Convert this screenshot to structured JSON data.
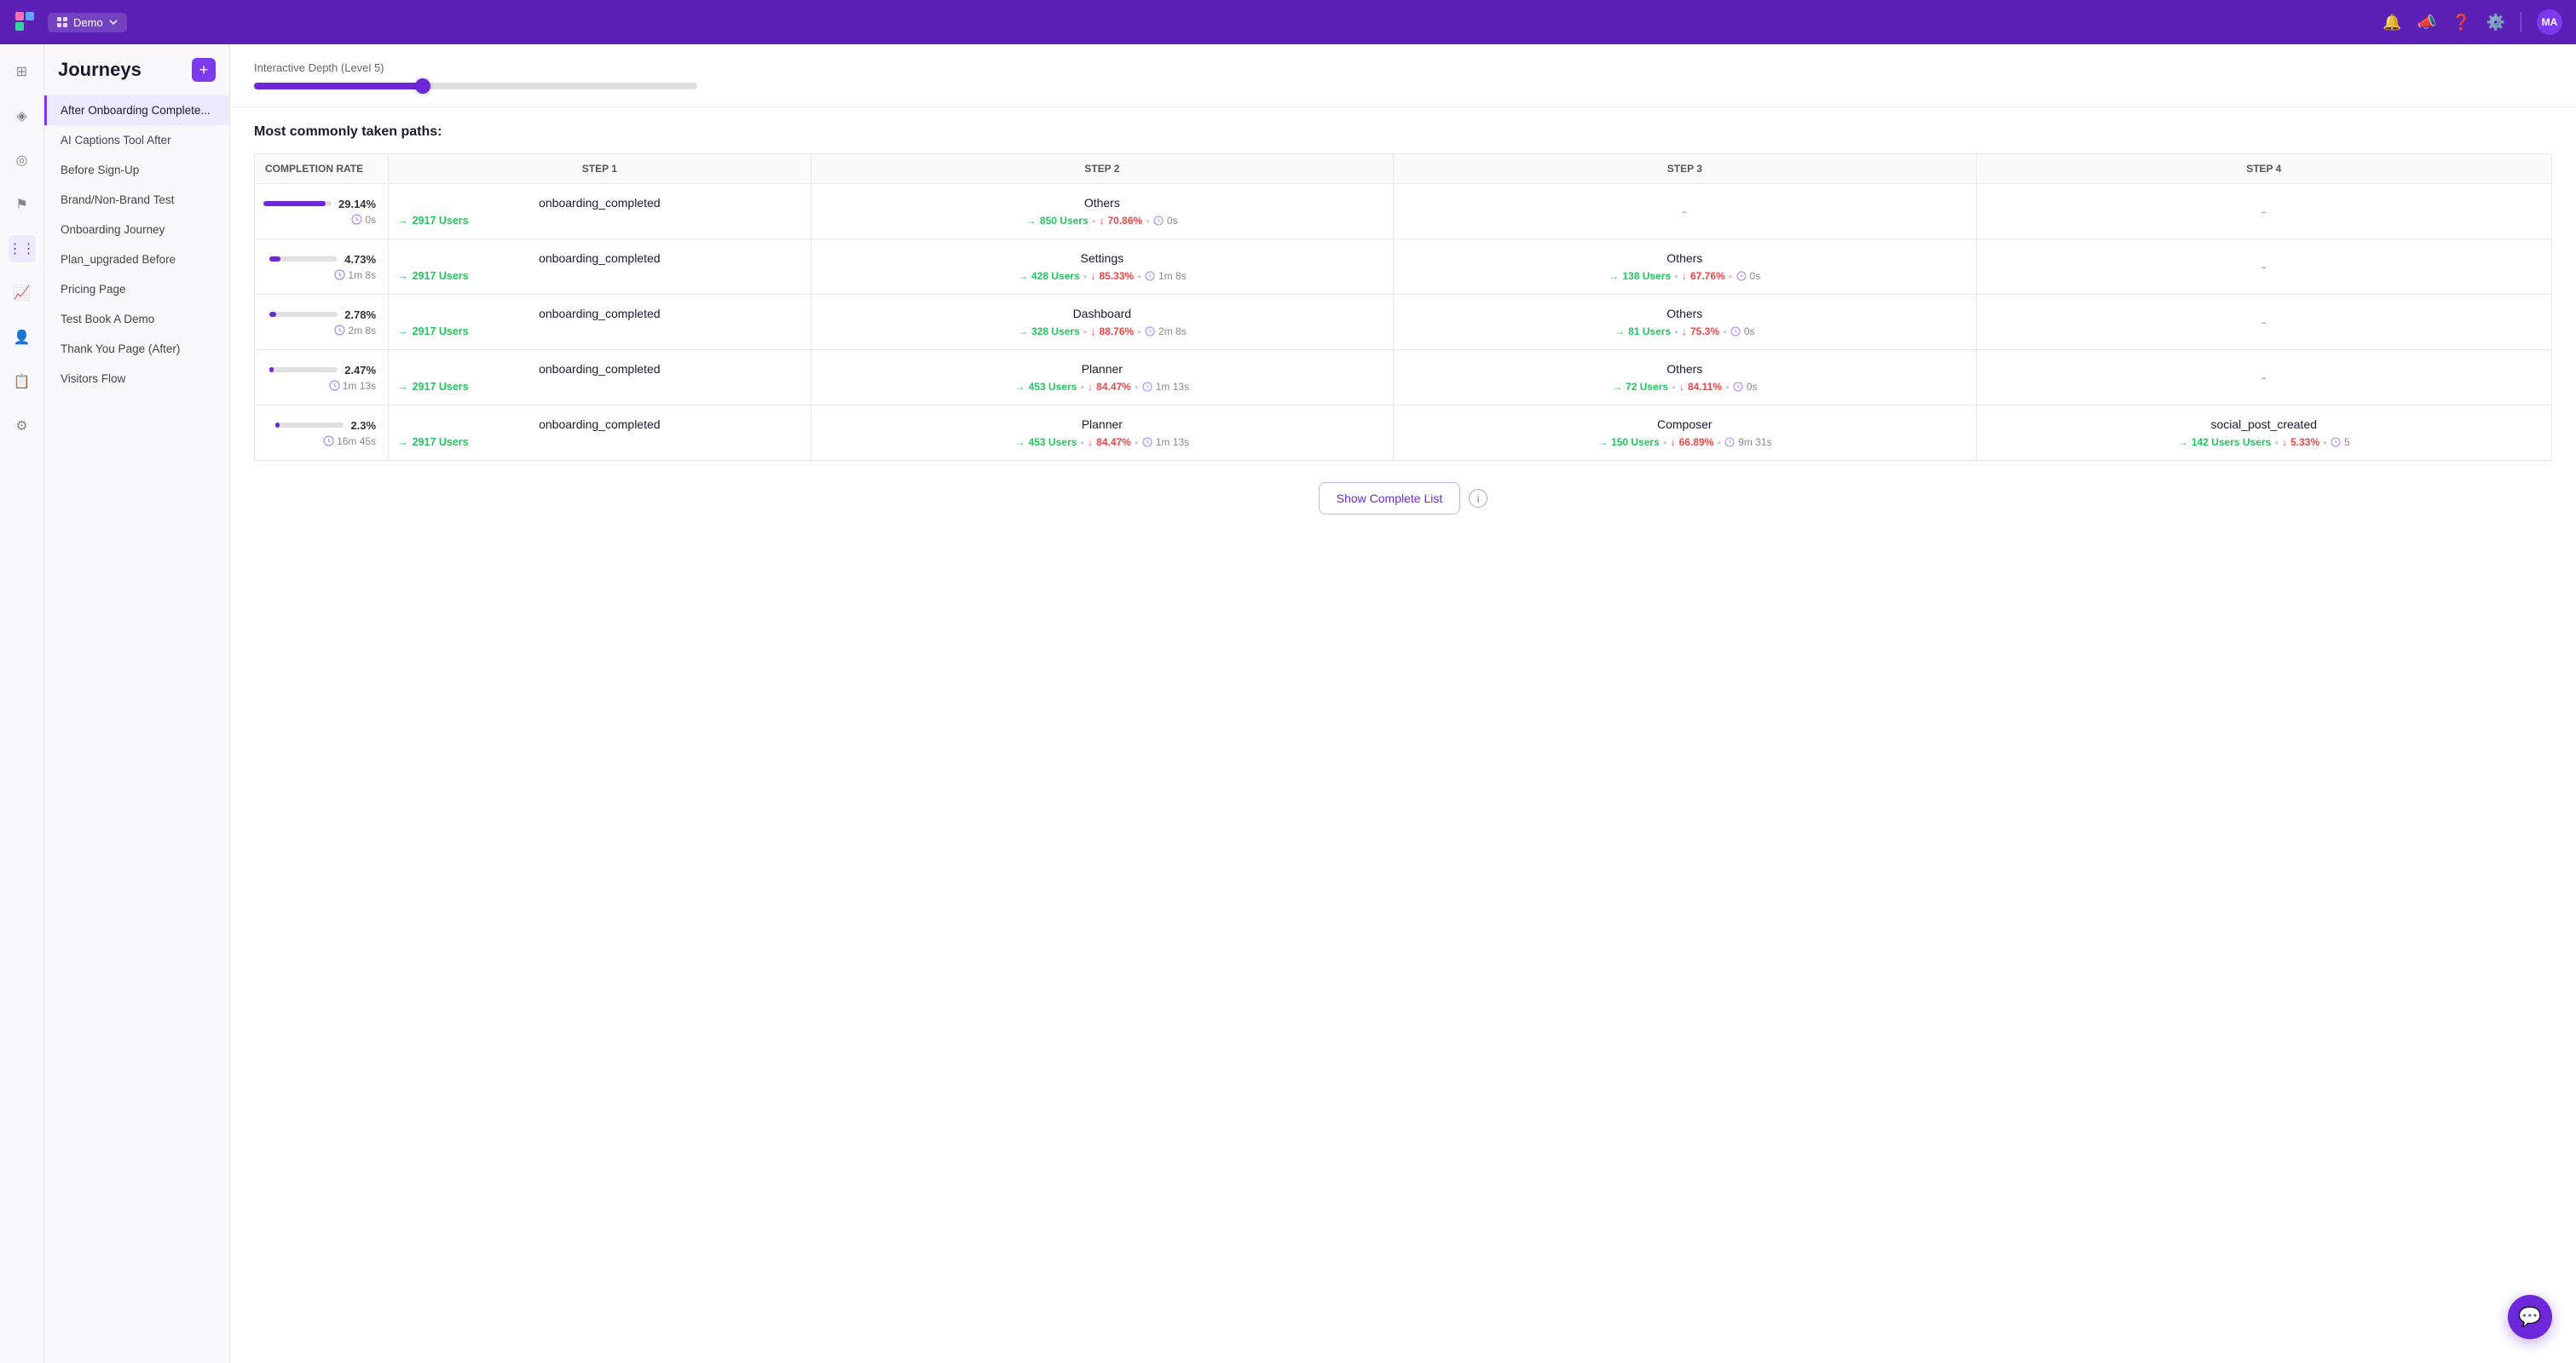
{
  "app": {
    "name": "Demo",
    "avatar": "MA"
  },
  "topnav": {
    "icons": [
      "bell",
      "megaphone",
      "question",
      "gear"
    ]
  },
  "sidebar": {
    "title": "Journeys",
    "items": [
      {
        "id": "after-onboarding",
        "label": "After Onboarding Complete...",
        "active": true
      },
      {
        "id": "ai-captions",
        "label": "AI Captions Tool After"
      },
      {
        "id": "before-signup",
        "label": "Before Sign-Up"
      },
      {
        "id": "brand-nonbrand",
        "label": "Brand/Non-Brand Test"
      },
      {
        "id": "onboarding-journey",
        "label": "Onboarding Journey"
      },
      {
        "id": "plan-upgraded",
        "label": "Plan_upgraded Before"
      },
      {
        "id": "pricing-page",
        "label": "Pricing Page"
      },
      {
        "id": "test-book-demo",
        "label": "Test Book A Demo"
      },
      {
        "id": "thank-you-page",
        "label": "Thank You Page (After)"
      },
      {
        "id": "visitors-flow",
        "label": "Visitors Flow"
      }
    ]
  },
  "depth_section": {
    "label": "Interactive Depth (Level 5)",
    "slider_pct": 38
  },
  "paths": {
    "title": "Most commonly taken paths:",
    "columns": [
      "COMPLETION RATE",
      "STEP 1",
      "STEP 2",
      "STEP 3",
      "STEP 4"
    ],
    "rows": [
      {
        "rate": "29.14%",
        "bar_pct": 29,
        "time": "0s",
        "step1_name": "onboarding_completed",
        "step1_users": "2917 Users",
        "step2_name": "Others",
        "step2_users": "850 Users",
        "step2_drop": "70.86%",
        "step2_time": "0s",
        "step3_name": "-",
        "step3_users": "",
        "step3_drop": "",
        "step3_time": "",
        "step4_name": "-"
      },
      {
        "rate": "4.73%",
        "bar_pct": 5,
        "time": "1m 8s",
        "step1_name": "onboarding_completed",
        "step1_users": "2917 Users",
        "step2_name": "Settings",
        "step2_users": "428 Users",
        "step2_drop": "85.33%",
        "step2_time": "1m 8s",
        "step3_name": "Others",
        "step3_users": "138 Users",
        "step3_drop": "67.76%",
        "step3_time": "0s",
        "step4_name": "-"
      },
      {
        "rate": "2.78%",
        "bar_pct": 3,
        "time": "2m 8s",
        "step1_name": "onboarding_completed",
        "step1_users": "2917 Users",
        "step2_name": "Dashboard",
        "step2_users": "328 Users",
        "step2_drop": "88.76%",
        "step2_time": "2m 8s",
        "step3_name": "Others",
        "step3_users": "81 Users",
        "step3_drop": "75.3%",
        "step3_time": "0s",
        "step4_name": "-"
      },
      {
        "rate": "2.47%",
        "bar_pct": 2,
        "time": "1m 13s",
        "step1_name": "onboarding_completed",
        "step1_users": "2917 Users",
        "step2_name": "Planner",
        "step2_users": "453 Users",
        "step2_drop": "84.47%",
        "step2_time": "1m 13s",
        "step3_name": "Others",
        "step3_users": "72 Users",
        "step3_drop": "84.11%",
        "step3_time": "0s",
        "step4_name": "-"
      },
      {
        "rate": "2.3%",
        "bar_pct": 2,
        "time": "16m 45s",
        "step1_name": "onboarding_completed",
        "step1_users": "2917 Users",
        "step2_name": "Planner",
        "step2_users": "453 Users",
        "step2_drop": "84.47%",
        "step2_time": "1m 13s",
        "step3_name": "Composer",
        "step3_users": "150 Users",
        "step3_drop": "66.89%",
        "step3_time": "9m 31s",
        "step4_name": "social_post_created",
        "step4_users": "142 Users",
        "step4_drop": "5.33%",
        "step4_time": "5"
      }
    ]
  },
  "show_complete_btn": "Show Complete List",
  "chat_bubble": "💬"
}
